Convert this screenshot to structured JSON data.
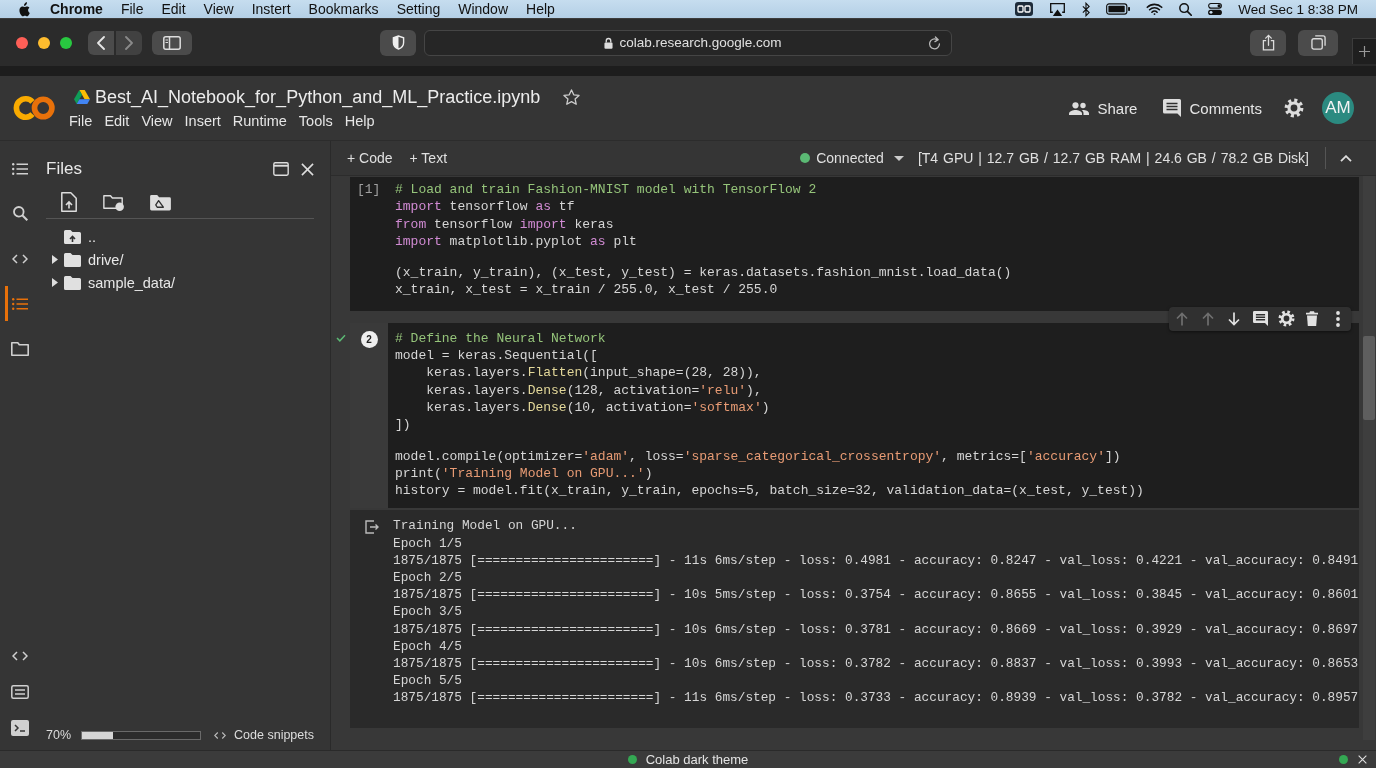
{
  "menu_bar": {
    "app": "Chrome",
    "items": [
      "File",
      "Edit",
      "View",
      "Instert",
      "Bookmarks",
      "Setting",
      "Window",
      "Help"
    ],
    "clock": "Wed Sec 1 8:38 PM"
  },
  "browser": {
    "nav": [
      {
        "kind": "back",
        "disabled": false
      },
      {
        "kind": "forward",
        "disabled": true
      }
    ],
    "url": "colab.research.google.com"
  },
  "header": {
    "title": "Best_AI_Notebook_for_Python_and_ML_Practice.ipynb",
    "starred": false,
    "menu": [
      "File",
      "Edit",
      "View",
      "Insert",
      "Runtime",
      "Tools",
      "Help"
    ],
    "share": "Share",
    "comments": "Comments",
    "avatar": "AM"
  },
  "toolbar": {
    "add": [
      "+ Code",
      "+ Text"
    ],
    "connected": true,
    "status": "Connected",
    "resources": "[T4 GPU | 12.7 GB / 12.7 GB RAM | 24.6 GB / 78.2 GB Disk]"
  },
  "rail": {
    "top": [
      {
        "kind": "list",
        "selected": false
      },
      {
        "kind": "search",
        "selected": false
      },
      {
        "kind": "code",
        "selected": false
      },
      {
        "kind": "list",
        "selected": true
      },
      {
        "kind": "folder",
        "selected": false
      }
    ],
    "bottom": [
      {
        "kind": "code"
      },
      {
        "kind": "form"
      },
      {
        "kind": "terminal"
      }
    ]
  },
  "files": {
    "title": "Files",
    "tree": [
      {
        "kind": "parent",
        "name": ".."
      },
      {
        "kind": "folder",
        "name": "drive/",
        "expanded": false
      },
      {
        "kind": "folder",
        "name": "sample_data/",
        "expanded": false
      }
    ],
    "reading": "70%",
    "level": 0.26,
    "snippets": "Code snippets"
  },
  "cells": [
    {
      "focused": false,
      "count": "[1]",
      "blocks": [
        [
          [
            {
              "kind": "comment",
              "text": "# Load and train Fashion-MNIST model with TensorFlow 2"
            }
          ],
          [
            {
              "kind": "keyword",
              "text": "import"
            },
            {
              "kind": "plain",
              "text": " tensorflow "
            },
            {
              "kind": "keyword",
              "text": "as"
            },
            {
              "kind": "plain",
              "text": " tf"
            }
          ],
          [
            {
              "kind": "keyword",
              "text": "from"
            },
            {
              "kind": "plain",
              "text": " tensorflow "
            },
            {
              "kind": "keyword",
              "text": "import"
            },
            {
              "kind": "plain",
              "text": " keras"
            }
          ],
          [
            {
              "kind": "keyword",
              "text": "import"
            },
            {
              "kind": "plain",
              "text": " matplotlib.pyplot "
            },
            {
              "kind": "keyword",
              "text": "as"
            },
            {
              "kind": "plain",
              "text": " plt"
            }
          ]
        ],
        [
          [
            {
              "kind": "plain",
              "text": "(x_train, y_train), (x_test, y_test) = keras.datasets.fashion_mnist.load_data()"
            }
          ],
          [
            {
              "kind": "plain",
              "text": "x_train, x_test = x_train / 255.0, x_test / 255.0"
            }
          ]
        ]
      ]
    },
    {
      "focused": true,
      "count": "2",
      "toolbar": [
        {
          "kind": "up",
          "disabled": true
        },
        {
          "kind": "up",
          "disabled": true
        },
        {
          "kind": "down",
          "disabled": false
        },
        {
          "kind": "comment",
          "disabled": false
        },
        {
          "kind": "settings",
          "disabled": false
        },
        {
          "kind": "delete",
          "disabled": false
        },
        {
          "kind": "more",
          "disabled": false
        }
      ],
      "blocks": [
        [
          [
            {
              "kind": "comment",
              "text": "# Define the Neural Network"
            }
          ],
          [
            {
              "kind": "plain",
              "text": "model = keras.Sequential(["
            }
          ],
          [
            {
              "kind": "plain",
              "text": "    keras.layers."
            },
            {
              "kind": "function",
              "text": "Flatten"
            },
            {
              "kind": "plain",
              "text": "(input_shape=(28, 28)),"
            }
          ],
          [
            {
              "kind": "plain",
              "text": "    keras.layers."
            },
            {
              "kind": "function",
              "text": "Dense"
            },
            {
              "kind": "plain",
              "text": "(128, activation="
            },
            {
              "kind": "string",
              "text": "'relu'"
            },
            {
              "kind": "plain",
              "text": "),"
            }
          ],
          [
            {
              "kind": "plain",
              "text": "    keras.layers."
            },
            {
              "kind": "function",
              "text": "Dense"
            },
            {
              "kind": "plain",
              "text": "(10, activation="
            },
            {
              "kind": "string",
              "text": "'softmax'"
            },
            {
              "kind": "plain",
              "text": ")"
            }
          ],
          [
            {
              "kind": "plain",
              "text": "])"
            }
          ]
        ],
        [
          [
            {
              "kind": "plain",
              "text": "model.compile(optimizer="
            },
            {
              "kind": "string",
              "text": "'adam'"
            },
            {
              "kind": "plain",
              "text": ", loss="
            },
            {
              "kind": "string",
              "text": "'sparse_categorical_crossentropy'"
            },
            {
              "kind": "plain",
              "text": ", metrics=["
            },
            {
              "kind": "string",
              "text": "'accuracy'"
            },
            {
              "kind": "plain",
              "text": "])"
            }
          ],
          [
            {
              "kind": "plain",
              "text": "print("
            },
            {
              "kind": "string",
              "text": "'Training Model on GPU...'"
            },
            {
              "kind": "plain",
              "text": ")"
            }
          ],
          [
            {
              "kind": "plain",
              "text": "history = model.fit(x_train, y_train, epochs=5, batch_size=32, validation_data=(x_test, y_test))"
            }
          ]
        ]
      ],
      "output": {
        "lines": [
          "Training Model on GPU...",
          "Epoch 1/5",
          "1875/1875 [=======================] - 11s 6ms/step - loss: 0.4981 - accuracy: 0.8247 - val_loss: 0.4221 - val_accuracy: 0.8491",
          "Epoch 2/5",
          "1875/1875 [=======================] - 10s 5ms/step - loss: 0.3754 - accuracy: 0.8655 - val_loss: 0.3845 - val_accuracy: 0.8601",
          "Epoch 3/5",
          "1875/1875 [=======================] - 10s 6ms/step - loss: 0.3781 - accuracy: 0.8669 - val_loss: 0.3929 - val_accuracy: 0.8697",
          "Epoch 4/5",
          "1875/1875 [=======================] - 10s 6ms/step - loss: 0.3782 - accuracy: 0.8837 - val_loss: 0.3993 - val_accuracy: 0.8653",
          "Epoch 5/5",
          "1875/1875 [=======================] - 11s 6ms/step - loss: 0.3733 - accuracy: 0.8939 - val_loss: 0.3782 - val_accuracy: 0.8957"
        ]
      }
    }
  ],
  "banner": {
    "text": "Colab dark theme"
  }
}
